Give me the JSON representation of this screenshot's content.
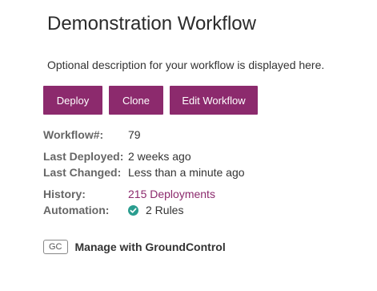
{
  "header": {
    "title": "Demonstration Workflow",
    "description": "Optional description for your workflow is displayed here."
  },
  "actions": {
    "deploy_label": "Deploy",
    "clone_label": "Clone",
    "edit_label": "Edit Workflow"
  },
  "details": {
    "workflow_number_label": "Workflow#:",
    "workflow_number_value": "79",
    "last_deployed_label": "Last Deployed:",
    "last_deployed_value": "2 weeks ago",
    "last_changed_label": "Last Changed:",
    "last_changed_value": "Less than a minute ago",
    "history_label": "History:",
    "history_value": "215 Deployments",
    "automation_label": "Automation:",
    "automation_value": "2 Rules",
    "automation_icon": "check-circle-icon"
  },
  "groundcontrol": {
    "badge": "GC",
    "label": "Manage with GroundControl"
  },
  "colors": {
    "accent": "#8c2a6d",
    "check": "#2a9d8f"
  }
}
